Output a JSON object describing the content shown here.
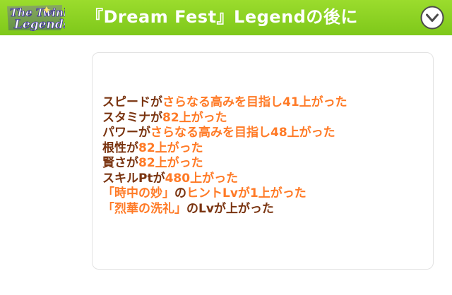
{
  "header": {
    "logo_text": "The Twinkle Legends",
    "title": "『Dream Fest』Legendの後に",
    "collapse_icon": "chevron-down-icon"
  },
  "colors": {
    "header_green": "#86cc1f",
    "text_brown": "#7a3410",
    "highlight_orange": "#ff7a26",
    "card_border": "#e2e2e2"
  },
  "effects": [
    [
      {
        "t": "スピードが",
        "h": false
      },
      {
        "t": "さらなる高みを目指し41上がった",
        "h": true
      }
    ],
    [
      {
        "t": "スタミナが",
        "h": false
      },
      {
        "t": "82上がった",
        "h": true
      }
    ],
    [
      {
        "t": "パワーが",
        "h": false
      },
      {
        "t": "さらなる高みを目指し48上がった",
        "h": true
      }
    ],
    [
      {
        "t": "根性が",
        "h": false
      },
      {
        "t": "82上がった",
        "h": true
      }
    ],
    [
      {
        "t": "賢さが",
        "h": false
      },
      {
        "t": "82上がった",
        "h": true
      }
    ],
    [
      {
        "t": "スキルPtが",
        "h": false
      },
      {
        "t": "480上がった",
        "h": true
      }
    ],
    [
      {
        "t": "「時中の妙」",
        "h": true
      },
      {
        "t": "の",
        "h": false
      },
      {
        "t": "ヒントLvが1上がった",
        "h": true
      }
    ],
    [
      {
        "t": "「烈華の洗礼」",
        "h": true
      },
      {
        "t": "のLvが上がった",
        "h": false
      }
    ]
  ]
}
